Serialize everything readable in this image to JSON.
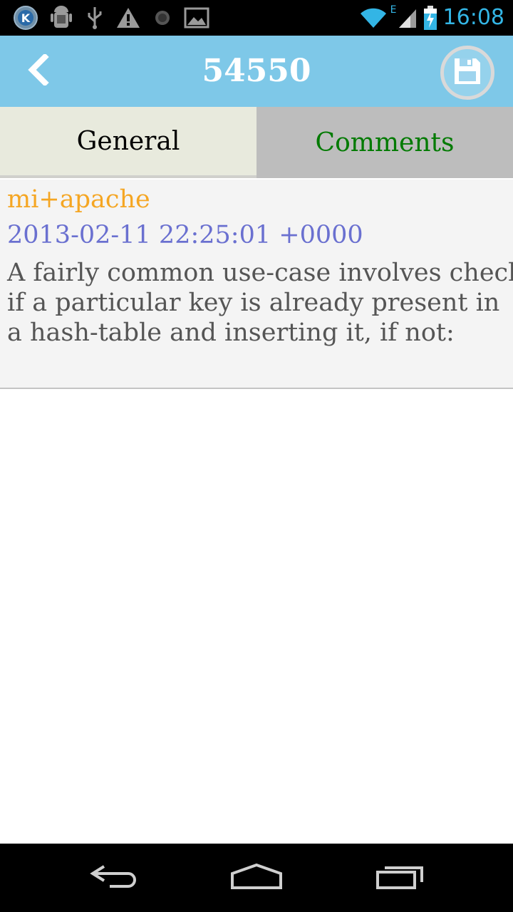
{
  "status_bar": {
    "time": "16:08",
    "network_label": "E",
    "icons": [
      "k-app-icon",
      "android-debug-icon",
      "usb-icon",
      "warning-icon",
      "dot-icon",
      "image-icon",
      "wifi-icon",
      "signal-icon",
      "battery-charging-icon"
    ]
  },
  "header": {
    "title": "54550",
    "back_icon": "chevron-left-icon",
    "save_icon": "floppy-disk-icon"
  },
  "tabs": [
    {
      "label": "General",
      "selected": false
    },
    {
      "label": "Comments",
      "selected": true
    }
  ],
  "comments": [
    {
      "author": "mi+apache",
      "date": "2013-02-11 22:25:01 +0000",
      "body_lines": [
        "A fairly common use-case involves checking",
        "if a particular key is already present in",
        "a hash-table and inserting it, if not:"
      ]
    }
  ],
  "colors": {
    "action_bar": "#7ec8e8",
    "author": "#f5a623",
    "date": "#6a70d0",
    "comments_tab_text": "#007a00",
    "status_time": "#33b5e5"
  },
  "nav_bar": {
    "icons": [
      "back-nav-icon",
      "home-nav-icon",
      "recents-nav-icon"
    ]
  }
}
